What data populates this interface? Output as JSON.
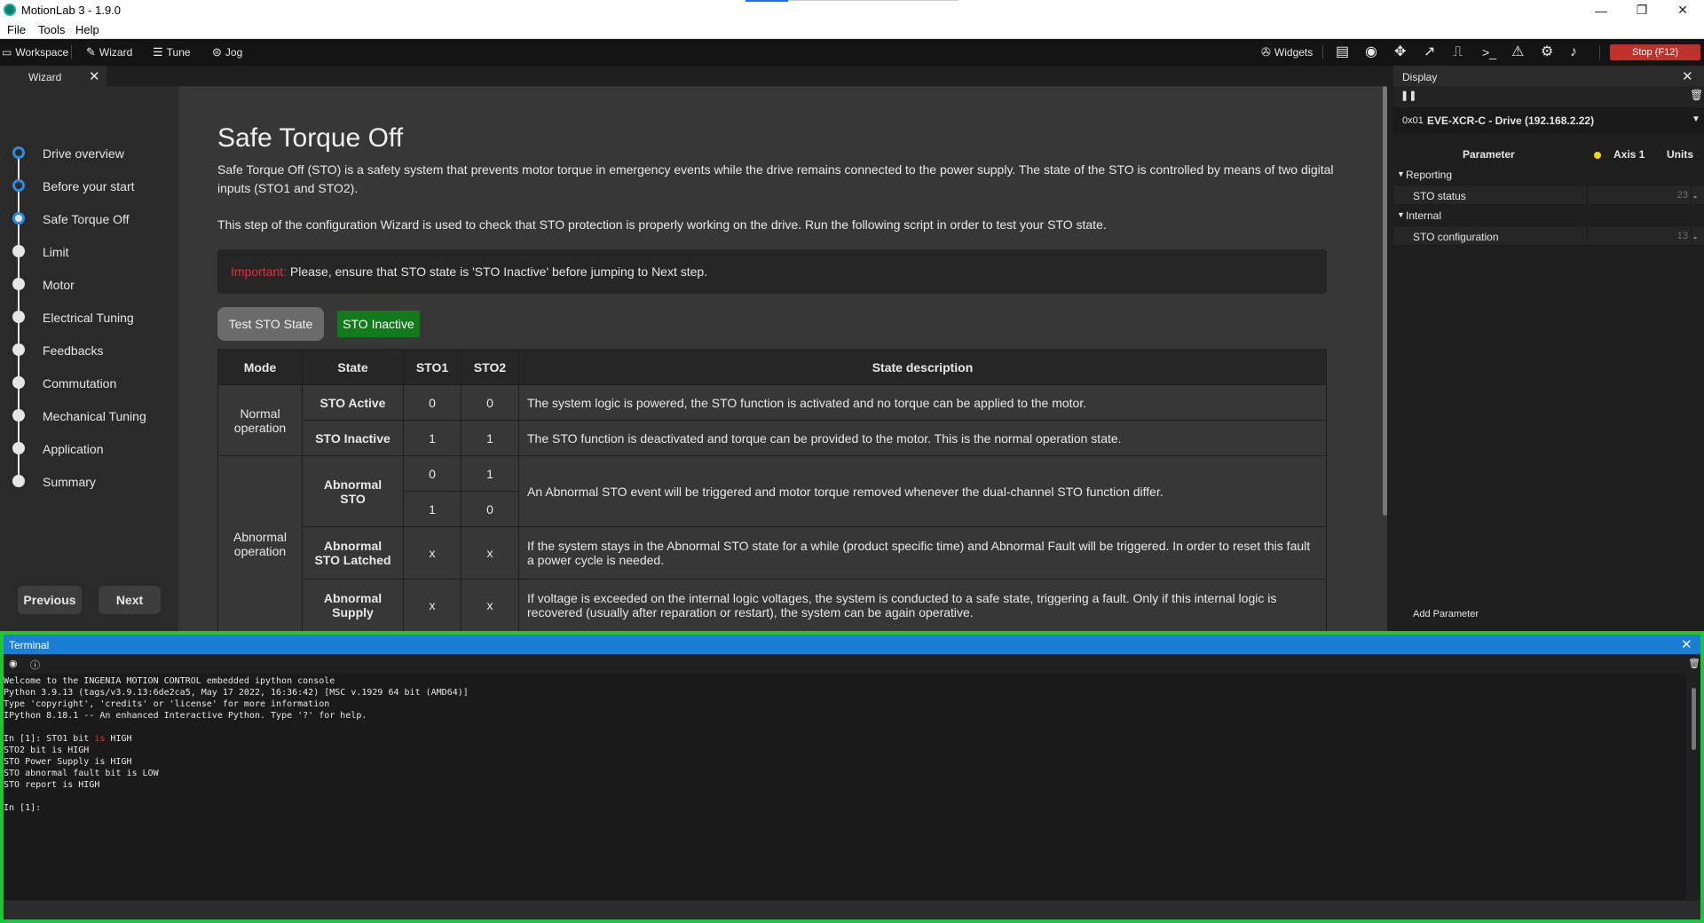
{
  "window": {
    "title": "MotionLab 3 - 1.9.0",
    "controls": {
      "minimize": "—",
      "restore": "❐",
      "close": "✕"
    }
  },
  "menu": [
    "File",
    "Tools",
    "Help"
  ],
  "toolbar": {
    "left": [
      {
        "label": "Workspace",
        "icon": "workspace-icon"
      },
      {
        "label": "Wizard",
        "icon": "wand-icon"
      },
      {
        "label": "Tune",
        "icon": "sliders-icon"
      },
      {
        "label": "Jog",
        "icon": "gamepad-icon"
      }
    ],
    "widgets_label": "Widgets",
    "right_icons": [
      "list-icon",
      "eye-icon",
      "move-icon",
      "chart-icon",
      "signal-icon",
      "terminal-icon",
      "warning-icon",
      "gear-icon",
      "bell-icon"
    ],
    "stop_label": "Stop (F12)",
    "stop_color": "#c0312b"
  },
  "wizard_tab": {
    "label": "Wizard"
  },
  "steps": [
    {
      "label": "Drive overview",
      "state": "done"
    },
    {
      "label": "Before your start",
      "state": "done"
    },
    {
      "label": "Safe Torque Off",
      "state": "current"
    },
    {
      "label": "Limit",
      "state": "pending"
    },
    {
      "label": "Motor",
      "state": "pending"
    },
    {
      "label": "Electrical Tuning",
      "state": "pending"
    },
    {
      "label": "Feedbacks",
      "state": "pending"
    },
    {
      "label": "Commutation",
      "state": "pending"
    },
    {
      "label": "Mechanical Tuning",
      "state": "pending"
    },
    {
      "label": "Application",
      "state": "pending"
    },
    {
      "label": "Summary",
      "state": "pending"
    }
  ],
  "nav": {
    "previous": "Previous",
    "next": "Next"
  },
  "content": {
    "title": "Safe Torque Off",
    "para1": "Safe Torque Off (STO) is a safety system that prevents motor torque in emergency events while the drive remains connected to the power supply. The state of the STO is controlled by means of two digital inputs (STO1 and STO2).",
    "para2": "This step of the configuration Wizard is used to check that STO protection is properly working on the drive. Run the following script in order to test your STO state.",
    "important_prefix": "Important:",
    "important_text": " Please, ensure that STO state is 'STO Inactive' before jumping to Next step.",
    "important_color": "#e0303a",
    "test_button": "Test STO State",
    "sto_badge": "STO Inactive",
    "sto_badge_color": "#127a1a"
  },
  "table": {
    "headers": [
      "Mode",
      "State",
      "STO1",
      "STO2",
      "State description"
    ],
    "normal_mode": "Normal operation",
    "abnormal_mode": "Abnormal operation",
    "rows": [
      {
        "state": "STO Active",
        "sto1": "0",
        "sto2": "0",
        "desc": "The system logic is powered, the STO function is activated and no torque can be applied to the motor."
      },
      {
        "state": "STO Inactive",
        "sto1": "1",
        "sto2": "1",
        "desc": "The STO function is deactivated and torque can be provided to the motor. This is the normal operation state."
      },
      {
        "state": "Abnormal STO",
        "sto1": "0",
        "sto2": "1",
        "sto1b": "1",
        "sto2b": "0",
        "desc": "An Abnormal STO event will be triggered and motor torque removed whenever the dual-channel STO function differ."
      },
      {
        "state": "Abnormal STO Latched",
        "sto1": "x",
        "sto2": "x",
        "desc": "If the system stays in the Abnormal STO state for a while (product specific time) and Abnormal Fault will be triggered. In order to reset this fault a power cycle is needed."
      },
      {
        "state": "Abnormal Supply",
        "sto1": "x",
        "sto2": "x",
        "desc": "If voltage is exceeded on the internal logic voltages, the system is conducted to a safe state, triggering a fault. Only if this internal logic is recovered (usually after reparation or restart), the system can be again operative."
      }
    ]
  },
  "display": {
    "title": "Display",
    "drive_id": "0x01",
    "drive_name": "EVE-XCR-C - Drive (192.168.2.22)",
    "columns": {
      "parameter": "Parameter",
      "axis": "Axis 1",
      "units": "Units"
    },
    "axis_dot_color": "#f2d600",
    "categories": [
      {
        "name": "Reporting",
        "params": [
          {
            "name": "STO status",
            "value": "23",
            "unit": "-"
          }
        ]
      },
      {
        "name": "Internal",
        "params": [
          {
            "name": "STO configuration",
            "value": "13",
            "unit": "-"
          }
        ]
      }
    ],
    "add_parameter": "Add Parameter"
  },
  "terminal": {
    "title": "Terminal",
    "lines": [
      "Welcome to the INGENIA MOTION CONTROL embedded ipython console",
      "Python 3.9.13 (tags/v3.9.13:6de2ca5, May 17 2022, 16:36:42) [MSC v.1929 64 bit (AMD64)]",
      "Type 'copyright', 'credits' or 'license' for more information",
      "IPython 8.18.1 -- An enhanced Interactive Python. Type '?' for help.",
      "",
      "In [1]: STO1 bit is HIGH",
      "STO2 bit is HIGH",
      "STO Power Supply is HIGH",
      "STO abnormal fault bit is LOW",
      "STO report is HIGH",
      "",
      "In [1]:"
    ],
    "border_color": "#1fc43a"
  }
}
